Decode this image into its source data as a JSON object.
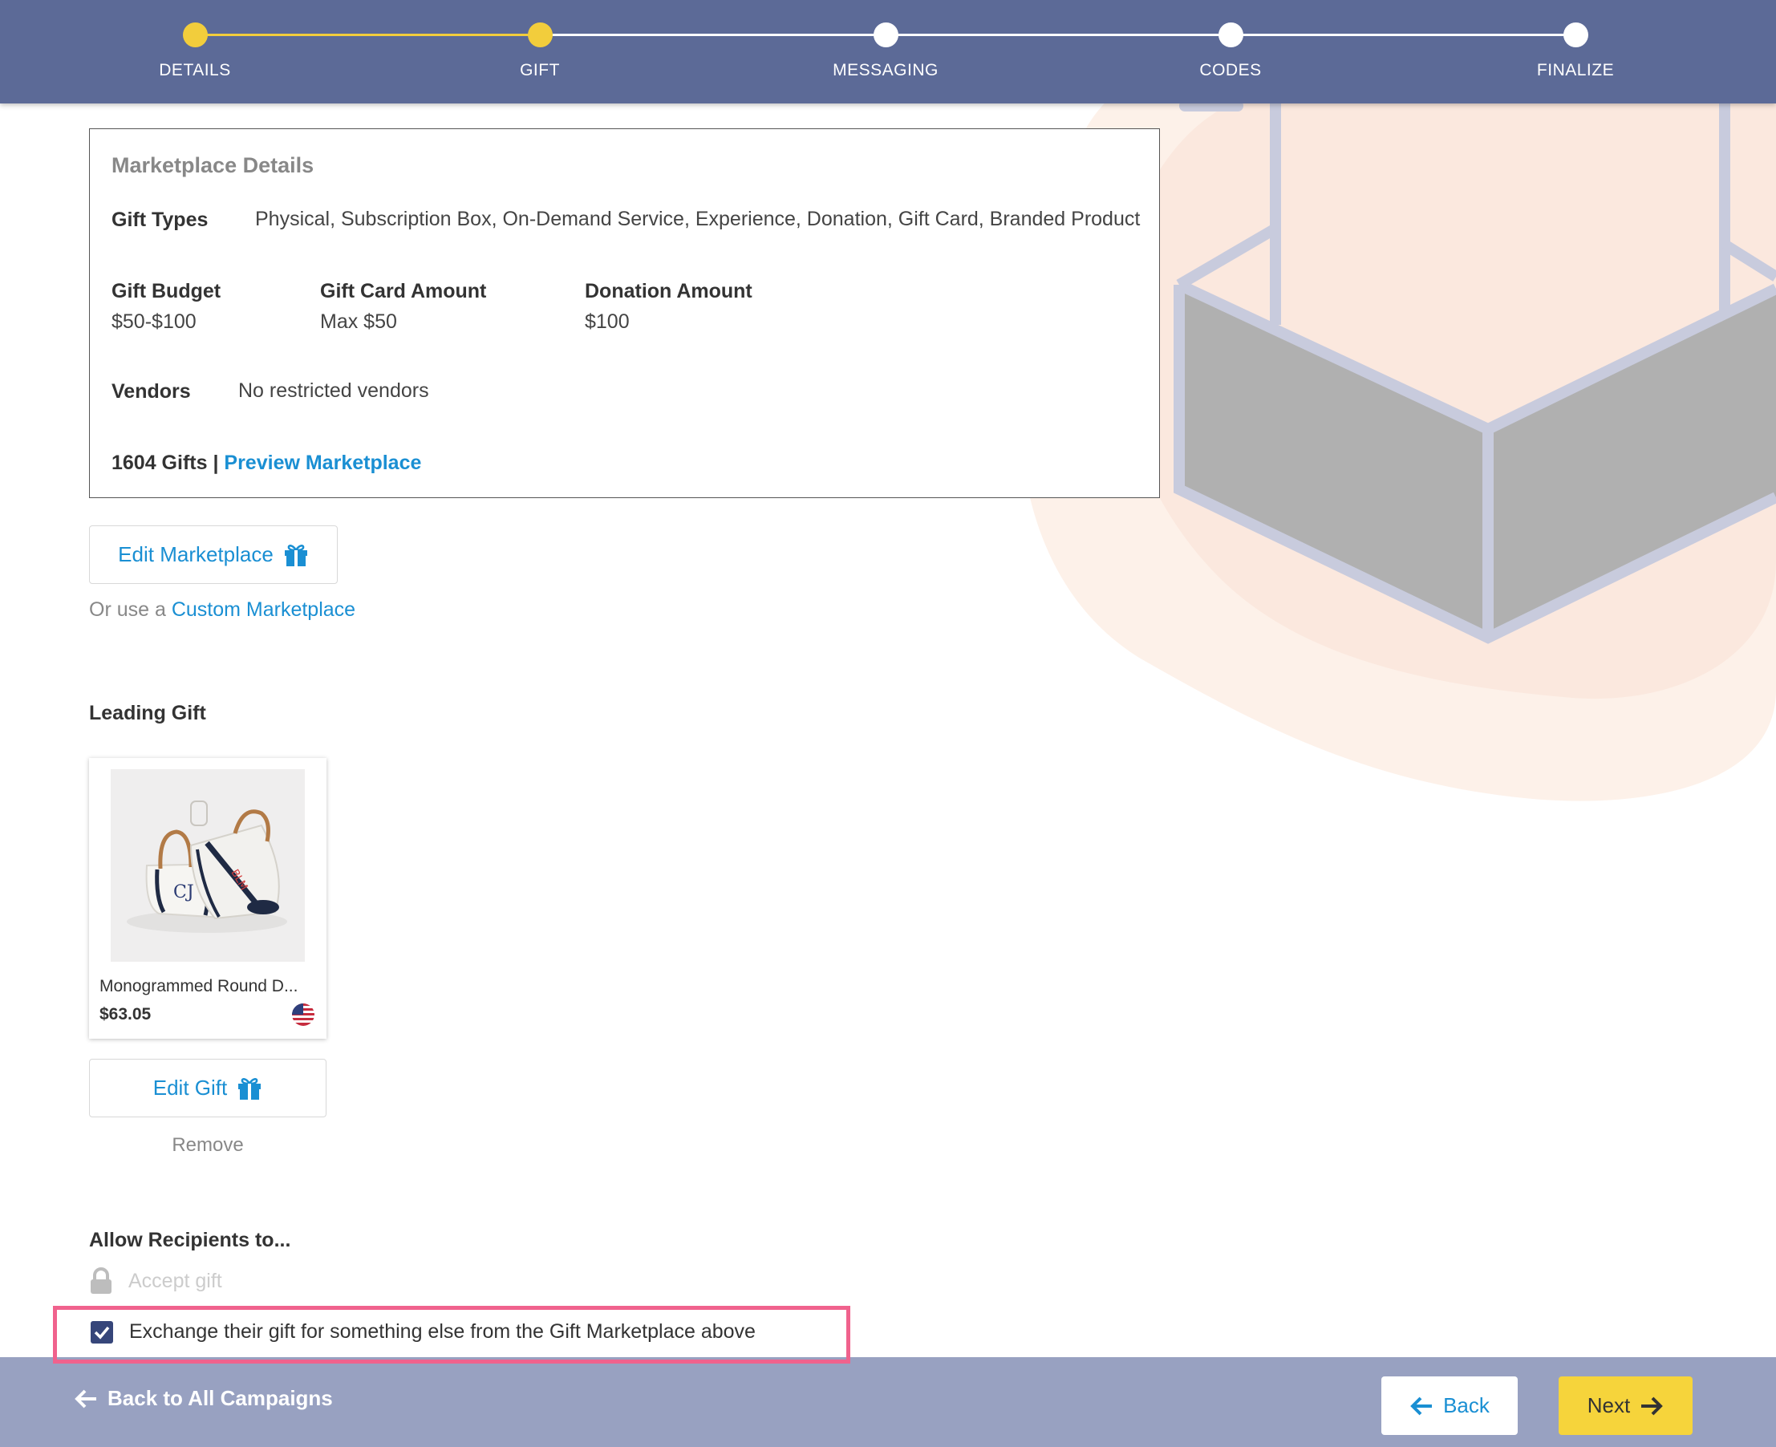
{
  "colors": {
    "header_bg": "#5c6a97",
    "step_done": "#f2cd3c",
    "step_todo": "#ffffff",
    "link": "#1a8fd3",
    "footer_bg": "#98a1c1",
    "next_button": "#f6d43b",
    "highlight": "#f0628d",
    "checkbox": "#36467a"
  },
  "stepper": {
    "steps": [
      {
        "label": "DETAILS",
        "state": "complete"
      },
      {
        "label": "GIFT",
        "state": "current"
      },
      {
        "label": "MESSAGING",
        "state": "upcoming"
      },
      {
        "label": "CODES",
        "state": "upcoming"
      },
      {
        "label": "FINALIZE",
        "state": "upcoming"
      }
    ]
  },
  "marketplace": {
    "title": "Marketplace Details",
    "gift_types_label": "Gift Types",
    "gift_types_value": "Physical, Subscription Box, On-Demand Service, Experience, Donation, Gift Card, Branded Product",
    "budget_label": "Gift Budget",
    "budget_value": "$50-$100",
    "gift_card_label": "Gift Card Amount",
    "gift_card_value": "Max $50",
    "donation_label": "Donation Amount",
    "donation_value": "$100",
    "vendors_label": "Vendors",
    "vendors_value": "No restricted vendors",
    "gift_count": "1604 Gifts |",
    "preview_link": "Preview Marketplace"
  },
  "edit_marketplace": {
    "label": "Edit Marketplace",
    "icon": "gift-icon"
  },
  "custom": {
    "prefix": "Or use a",
    "link": "Custom Marketplace"
  },
  "leading_gift": {
    "heading": "Leading Gift",
    "name": "Monogrammed Round D...",
    "price": "$63.05",
    "flag_icon": "us-flag-icon",
    "edit_label": "Edit Gift",
    "remove_label": "Remove"
  },
  "allow": {
    "heading": "Allow Recipients to...",
    "accept_label": "Accept gift",
    "accept_locked": true,
    "exchange_label": "Exchange their gift for something else from the Gift Marketplace above",
    "exchange_checked": true
  },
  "footer": {
    "back_all_label": "Back to All Campaigns",
    "back_label": "Back",
    "next_label": "Next"
  }
}
